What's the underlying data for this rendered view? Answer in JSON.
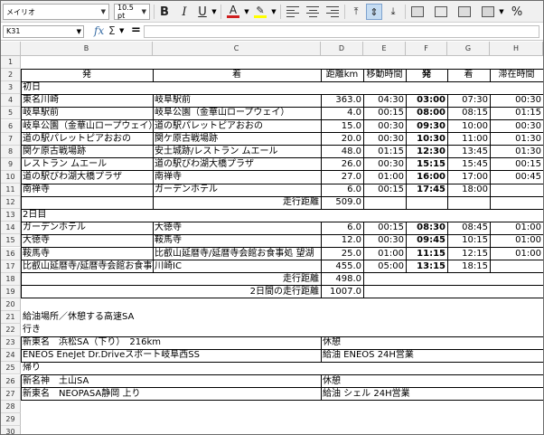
{
  "toolbar": {
    "font_name": "メイリオ",
    "font_size": "10.5 pt",
    "bold": "B",
    "italic": "I",
    "underline": "U",
    "font_color_letter": "A",
    "font_color": "#d02020",
    "highlight_color": "#ffff00",
    "percent": "%",
    "icons": [
      "bold-icon",
      "italic-icon",
      "underline-icon",
      "font-color-icon",
      "highlight-icon",
      "align-left-icon",
      "align-center-icon",
      "align-right-icon",
      "align-top-icon",
      "align-middle-icon",
      "align-bottom-icon",
      "merge-icon",
      "wrap-icon",
      "format-currency-icon",
      "format-percent-icon"
    ]
  },
  "formula_bar": {
    "cell_ref": "K31",
    "fx": "fx",
    "sigma": "Σ",
    "equals": "=",
    "value": ""
  },
  "columns": [
    "B",
    "C",
    "D",
    "E",
    "F",
    "G",
    "H"
  ],
  "rows": [
    "1",
    "2",
    "3",
    "4",
    "5",
    "6",
    "7",
    "8",
    "9",
    "10",
    "11",
    "12",
    "13",
    "14",
    "15",
    "16",
    "17",
    "18",
    "19",
    "20",
    "21",
    "22",
    "23",
    "24",
    "25",
    "26",
    "27",
    "28",
    "29",
    "30"
  ],
  "header": {
    "from": "発",
    "to": "着",
    "distance": "距離km",
    "travel": "移動時間",
    "depart": "発",
    "arrive": "着",
    "stay": "滞在時間"
  },
  "day1": {
    "label": "初日",
    "rows": [
      {
        "from": "東名川崎",
        "to": "岐阜駅前",
        "km": "363.0",
        "travel": "04:30",
        "depart": "03:00",
        "arrive": "07:30",
        "stay": "00:30"
      },
      {
        "from": "岐阜駅前",
        "to": "岐阜公園（金華山ロープウェイ）",
        "km": "4.0",
        "travel": "00:15",
        "depart": "08:00",
        "arrive": "08:15",
        "stay": "01:15"
      },
      {
        "from": "岐阜公園（金華山ロープウェイ）",
        "to": "道の駅パレットピアおおの",
        "km": "15.0",
        "travel": "00:30",
        "depart": "09:30",
        "arrive": "10:00",
        "stay": "00:30"
      },
      {
        "from": "道の駅パレットピアおおの",
        "to": "関ケ原古戦場跡",
        "km": "20.0",
        "travel": "00:30",
        "depart": "10:30",
        "arrive": "11:00",
        "stay": "01:30"
      },
      {
        "from": "関ケ原古戦場跡",
        "to": "安土城跡/レストラン ムエール",
        "km": "48.0",
        "travel": "01:15",
        "depart": "12:30",
        "arrive": "13:45",
        "stay": "01:30"
      },
      {
        "from": "レストラン ムエール",
        "to": "道の駅びわ湖大橋プラザ",
        "km": "26.0",
        "travel": "00:30",
        "depart": "15:15",
        "arrive": "15:45",
        "stay": "00:15"
      },
      {
        "from": "道の駅びわ湖大橋プラザ",
        "to": "南禅寺",
        "km": "27.0",
        "travel": "01:00",
        "depart": "16:00",
        "arrive": "17:00",
        "stay": "00:45"
      },
      {
        "from": "南禅寺",
        "to": "ガーデンホテル",
        "km": "6.0",
        "travel": "00:15",
        "depart": "17:45",
        "arrive": "18:00",
        "stay": ""
      }
    ],
    "total_label": "走行距離",
    "total_km": "509.0"
  },
  "day2": {
    "label": "2日目",
    "rows": [
      {
        "from": "ガーデンホテル",
        "to": "大徳寺",
        "km": "6.0",
        "travel": "00:15",
        "depart": "08:30",
        "arrive": "08:45",
        "stay": "01:00"
      },
      {
        "from": "大徳寺",
        "to": "鞍馬寺",
        "km": "12.0",
        "travel": "00:30",
        "depart": "09:45",
        "arrive": "10:15",
        "stay": "01:00"
      },
      {
        "from": "鞍馬寺",
        "to": "比叡山延暦寺/延暦寺会館お食事処 望湖",
        "km": "25.0",
        "travel": "01:00",
        "depart": "11:15",
        "arrive": "12:15",
        "stay": "01:00"
      },
      {
        "from": "比叡山延暦寺/延暦寺会館お食事処",
        "to": "川崎IC",
        "km": "455.0",
        "travel": "05:00",
        "depart": "13:15",
        "arrive": "18:15",
        "stay": ""
      }
    ],
    "total_label": "走行距離",
    "total_km": "498.0",
    "grand_label": "2日間の走行距離",
    "grand_km": "1007.0"
  },
  "fuel": {
    "title": "給油場所／休憩する高速SA",
    "outbound_label": "行き",
    "outbound": [
      {
        "place": "新東名　浜松SA（下り）　216km",
        "note": "休憩"
      },
      {
        "place": "ENEOS EneJet Dr.Driveスポート岐阜西SS",
        "note": "給油 ENEOS 24H営業"
      }
    ],
    "return_label": "帰り",
    "return": [
      {
        "place": "新名神　土山SA",
        "note": "休憩"
      },
      {
        "place": "新東名　NEOPASA静岡 上り",
        "note": "給油 シェル 24H営業"
      }
    ]
  }
}
